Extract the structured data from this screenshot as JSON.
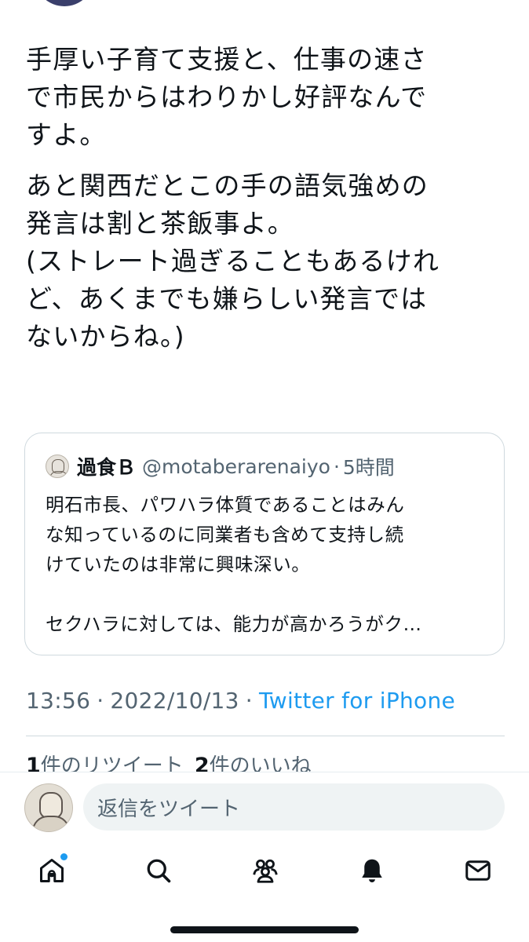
{
  "tweet": {
    "paragraph1": "手厚い子育て支援と、仕事の速さ\nで市民からはわりかし好評なんで\nすよ。",
    "paragraph2": "あと関西だとこの手の語気強めの\n発言は割と茶飯事よ。\n(ストレート過ぎることもあるけれ\nど、あくまでも嫌らしい発言では\nないからね。)"
  },
  "quote": {
    "name": "過食Ｂ",
    "handle": "@motaberarenaiyo",
    "dot": "·",
    "time": "5時間",
    "text": "明石市長、パワハラ体質であることはみん\nな知っているのに同業者も含めて支持し続\nけていたのは非常に興味深い。\n\nセクハラに対しては、能力が高かろうがク…"
  },
  "meta": {
    "time": "13:56",
    "sep": "·",
    "date": "2022/10/13",
    "source": "Twitter for iPhone"
  },
  "stats": {
    "retweet_count": "1",
    "retweet_label": "件のリツイート",
    "like_count": "2",
    "like_label": "件のいいね"
  },
  "reply": {
    "placeholder": "返信をツイート"
  },
  "tabbar": {
    "icons": [
      "home-icon",
      "search-icon",
      "communities-icon",
      "notifications-icon",
      "messages-icon"
    ],
    "home_has_badge": true
  },
  "colors": {
    "accent": "#1d9bf0",
    "text": "#0f1419",
    "secondary": "#536471",
    "border": "#cfd9de"
  }
}
